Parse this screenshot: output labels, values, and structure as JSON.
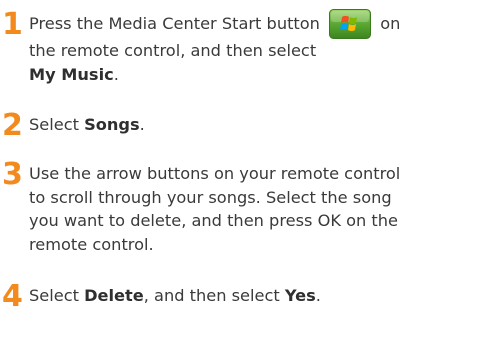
{
  "steps": [
    {
      "number": "1",
      "line1_before": "Press the Media Center Start button",
      "line1_after": "on",
      "line2": "the remote control, and then select",
      "line3_bold": "My Music",
      "line3_end": ".",
      "button_icon": "windows-start-button-icon"
    },
    {
      "number": "2",
      "text_before": "Select ",
      "bold": "Songs",
      "text_after": "."
    },
    {
      "number": "3",
      "lines": [
        "Use the arrow buttons on your remote control",
        "to scroll through your songs. Select the song",
        "you want to delete, and then press OK on the",
        "remote control."
      ]
    },
    {
      "number": "4",
      "text_before": "Select ",
      "bold1": "Delete",
      "text_mid": ", and then select ",
      "bold2": "Yes",
      "text_after": "."
    }
  ],
  "colors": {
    "step_number": "#f28a1e",
    "body_text": "#3a3a3a",
    "button_green": "#5aa832"
  }
}
